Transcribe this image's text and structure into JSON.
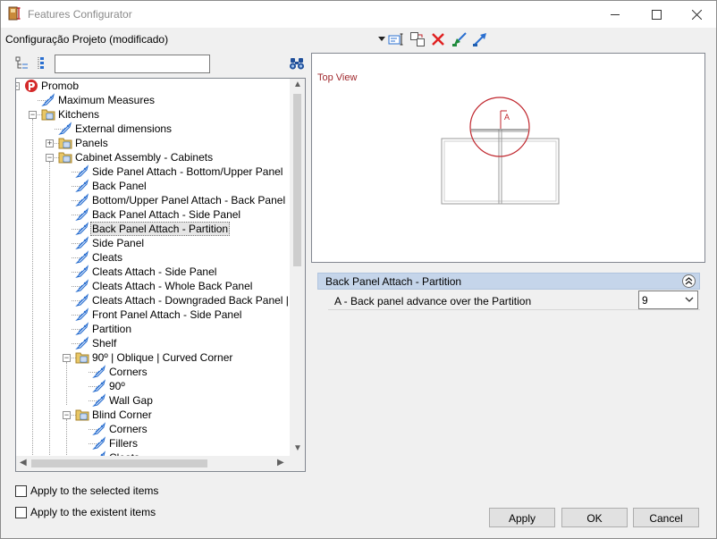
{
  "window": {
    "title": "Features Configurator"
  },
  "toolbar": {
    "config_label": "Configuração Projeto (modificado)"
  },
  "search": {
    "value": "",
    "placeholder": ""
  },
  "tree": [
    {
      "label": "Promob",
      "level": 0,
      "icon": "promob-logo-icon",
      "expander": "minus"
    },
    {
      "label": "Maximum Measures",
      "level": 1,
      "icon": "tag-icon"
    },
    {
      "label": "Kitchens",
      "level": 1,
      "icon": "folder-icon",
      "expander": "minus"
    },
    {
      "label": "External dimensions",
      "level": 2,
      "icon": "tag-icon"
    },
    {
      "label": "Panels",
      "level": 2,
      "icon": "folder-icon",
      "expander": "plus"
    },
    {
      "label": "Cabinet Assembly - Cabinets",
      "level": 2,
      "icon": "folder-icon",
      "expander": "minus"
    },
    {
      "label": "Side Panel Attach - Bottom/Upper Panel",
      "level": 3,
      "icon": "tag-icon"
    },
    {
      "label": "Back Panel",
      "level": 3,
      "icon": "tag-icon"
    },
    {
      "label": " Bottom/Upper Panel Attach - Back Panel",
      "level": 3,
      "icon": "tag-icon"
    },
    {
      "label": "Back Panel Attach - Side Panel",
      "level": 3,
      "icon": "tag-icon"
    },
    {
      "label": "Back Panel Attach - Partition",
      "level": 3,
      "icon": "tag-icon",
      "selected": true
    },
    {
      "label": "Side Panel",
      "level": 3,
      "icon": "tag-icon"
    },
    {
      "label": "Cleats",
      "level": 3,
      "icon": "tag-icon"
    },
    {
      "label": "Cleats Attach - Side Panel",
      "level": 3,
      "icon": "tag-icon"
    },
    {
      "label": "Cleats Attach - Whole Back Panel",
      "level": 3,
      "icon": "tag-icon"
    },
    {
      "label": "Cleats Attach - Downgraded Back Panel | B",
      "level": 3,
      "icon": "tag-icon"
    },
    {
      "label": "Front Panel Attach - Side Panel",
      "level": 3,
      "icon": "tag-icon"
    },
    {
      "label": "Partition",
      "level": 3,
      "icon": "tag-icon"
    },
    {
      "label": "Shelf",
      "level": 3,
      "icon": "tag-icon"
    },
    {
      "label": "90º | Oblique | Curved Corner",
      "level": 3,
      "icon": "folder-icon",
      "expander": "minus"
    },
    {
      "label": "Corners",
      "level": 4,
      "icon": "tag-icon"
    },
    {
      "label": "90º",
      "level": 4,
      "icon": "tag-icon"
    },
    {
      "label": "Wall Gap",
      "level": 4,
      "icon": "tag-icon"
    },
    {
      "label": "Blind Corner",
      "level": 3,
      "icon": "folder-icon",
      "expander": "minus"
    },
    {
      "label": "Corners",
      "level": 4,
      "icon": "tag-icon"
    },
    {
      "label": "Fillers",
      "level": 4,
      "icon": "tag-icon"
    },
    {
      "label": "Cleats",
      "level": 4,
      "icon": "tag-icon"
    }
  ],
  "preview": {
    "title": "Top View",
    "dimension_label": "A"
  },
  "properties": {
    "section_title": "Back Panel Attach - Partition",
    "rows": [
      {
        "name": "A - Back panel advance over the Partition",
        "value": "9"
      }
    ]
  },
  "options": {
    "apply_selected": {
      "label": "Apply to the selected items",
      "checked": false
    },
    "apply_existent": {
      "label": "Apply to the existent items",
      "checked": false
    }
  },
  "buttons": {
    "apply": "Apply",
    "ok": "OK",
    "cancel": "Cancel"
  },
  "colors": {
    "accent_red": "#c0262d",
    "header_blue": "#c5d5ea",
    "icon_blue": "#2a6fd0",
    "folder_yellow": "#e9c766"
  }
}
